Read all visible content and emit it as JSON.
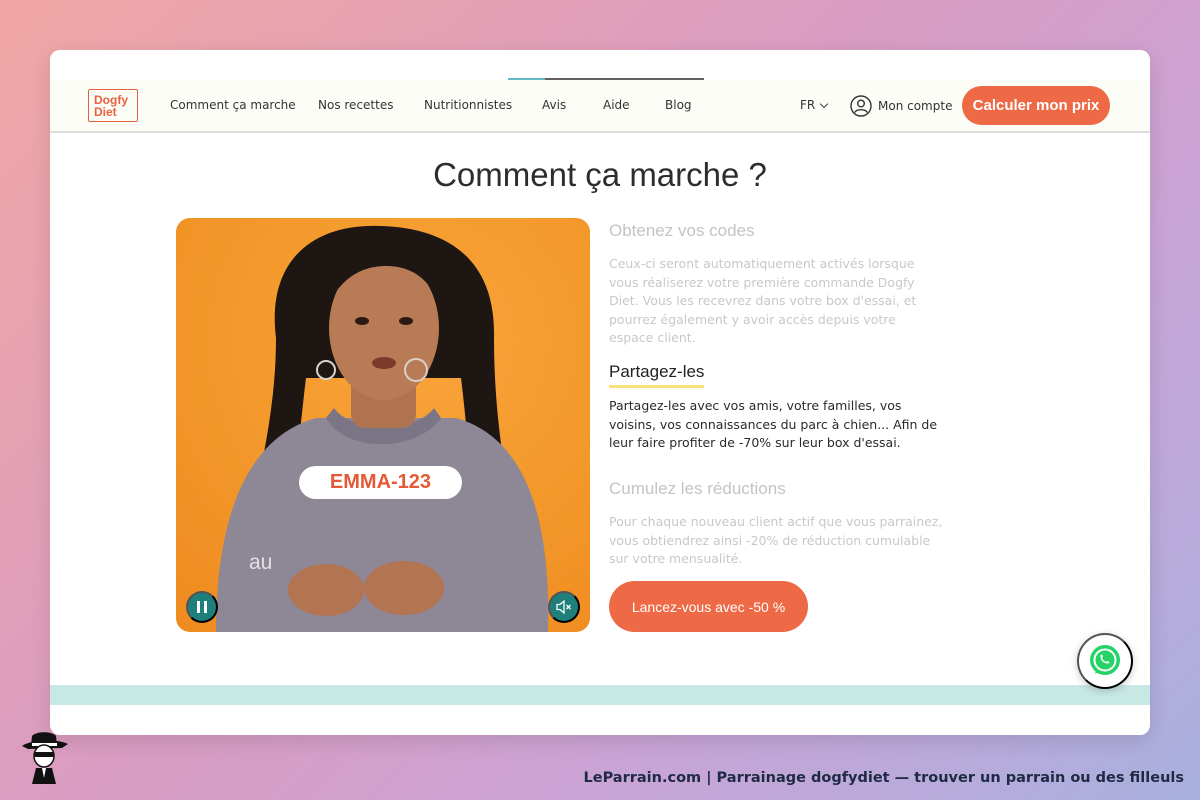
{
  "brand": {
    "logo_line1": "Dogfy",
    "logo_line2": "Diet"
  },
  "nav": {
    "links": [
      "Comment ça marche",
      "Nos recettes",
      "Nutritionnistes",
      "Avis",
      "Aide",
      "Blog"
    ],
    "lang": "FR",
    "account_label": "Mon compte",
    "cta": "Calculer mon prix"
  },
  "video_progress": 0.19,
  "page_title": "Comment ça marche ?",
  "video": {
    "code": "EMMA-123",
    "caption": "au",
    "pause_icon": "pause-icon",
    "mute_icon": "speaker-muted-icon"
  },
  "steps": [
    {
      "title": "Obtenez vos codes",
      "text": "Ceux-ci seront automatiquement activés lorsque vous réaliserez votre première commande Dogfy Diet. Vous les recevrez dans votre box d'essai, et pourrez également y avoir accès depuis votre espace client.",
      "active": false
    },
    {
      "title": "Partagez-les",
      "text": "Partagez-les avec vos amis, votre familles, vos voisins, vos connaissances du parc à chien... Afin de leur faire profiter de -70% sur leur box d'essai.",
      "active": true
    },
    {
      "title": "Cumulez les réductions",
      "text": "Pour chaque nouveau client actif que vous parrainez, vous obtiendrez ainsi -20% de réduction cumulable sur votre mensualité.",
      "active": false
    }
  ],
  "main_cta": "Lancez-vous avec -50 %",
  "footer": {
    "text": "LeParrain.com | Parrainage dogfydiet — trouver un parrain ou des filleuls"
  },
  "colors": {
    "accent": "#ee6a47",
    "teal": "#1f7f7a",
    "highlight": "#f6e07a",
    "whatsapp": "#25d366"
  }
}
